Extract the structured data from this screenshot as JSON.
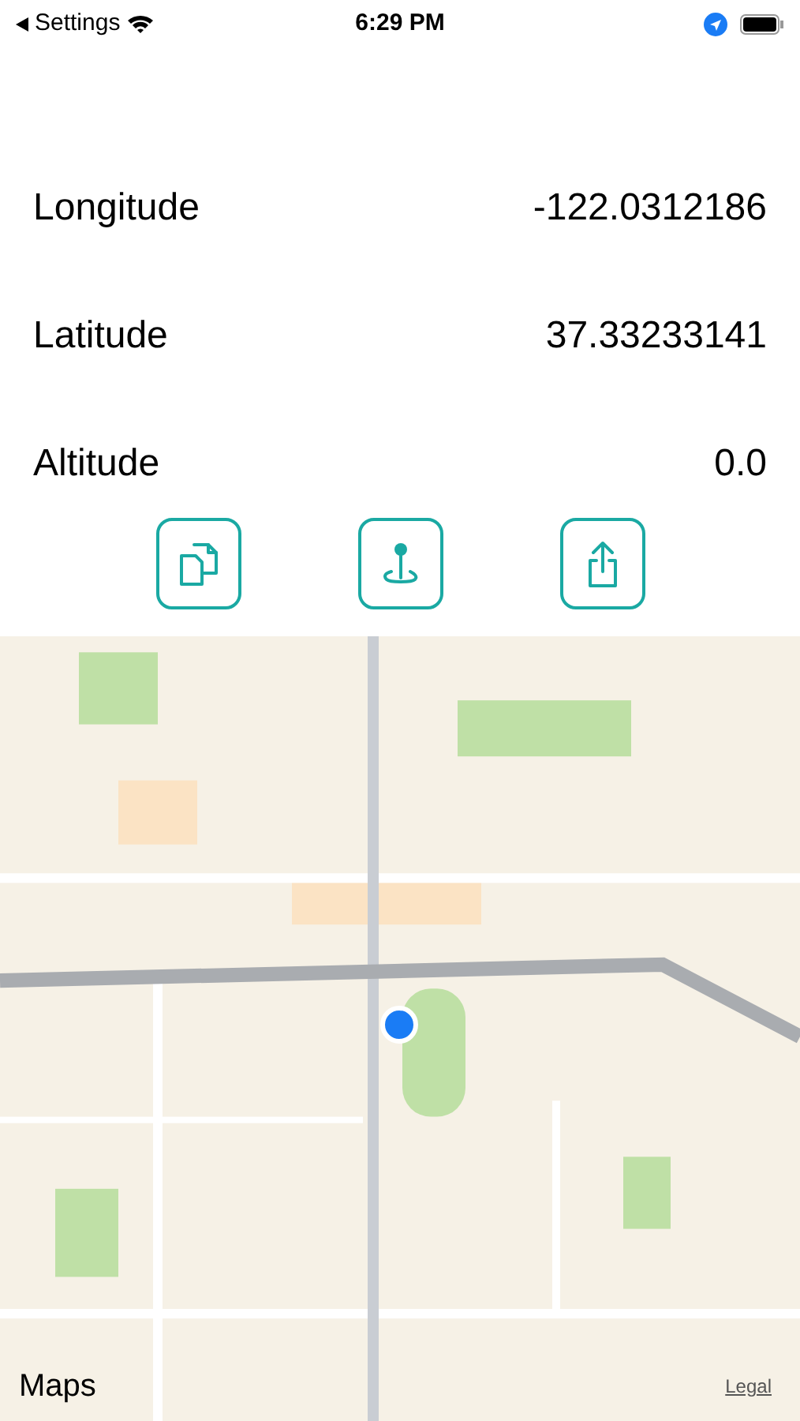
{
  "status_bar": {
    "back_label": "Settings",
    "time": "6:29 PM"
  },
  "readings": [
    {
      "label": "Longitude",
      "value": "-122.0312186"
    },
    {
      "label": "Latitude",
      "value": "37.33233141"
    },
    {
      "label": "Altitude",
      "value": "0.0"
    }
  ],
  "actions": [
    {
      "kind": "copy"
    },
    {
      "kind": "pin"
    },
    {
      "kind": "share"
    }
  ],
  "map": {
    "logo": "Maps",
    "legal_link": "Legal"
  }
}
